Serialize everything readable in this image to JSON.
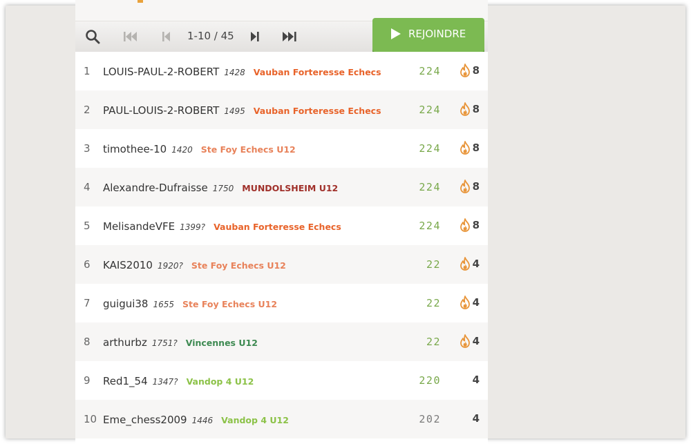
{
  "toolbar": {
    "page_info": "1-10 / 45",
    "join_label": "REJOINDRE"
  },
  "colors": {
    "score_green": "#78a84a",
    "score_gray": "#7a7a7a",
    "team_orange": "#e8632a",
    "team_salmon": "#e8825a",
    "team_darkred": "#a0302a",
    "team_green": "#3e8a52",
    "team_lime": "#8cc248",
    "fire": "#e8953a",
    "join_button": "#7cba52"
  },
  "players": [
    {
      "rank": "1",
      "name": "LOUIS-PAUL-2-ROBERT",
      "rating": "1428",
      "team": "Vauban Forteresse Echecs",
      "team_color": "#e8632a",
      "score": "224",
      "score_color": "#78a84a",
      "fire": true,
      "streak": "8"
    },
    {
      "rank": "2",
      "name": "PAUL-LOUIS-2-ROBERT",
      "rating": "1495",
      "team": "Vauban Forteresse Echecs",
      "team_color": "#e8632a",
      "score": "224",
      "score_color": "#78a84a",
      "fire": true,
      "streak": "8"
    },
    {
      "rank": "3",
      "name": "timothee-10",
      "rating": "1420",
      "team": "Ste Foy Echecs U12",
      "team_color": "#e8825a",
      "score": "224",
      "score_color": "#78a84a",
      "fire": true,
      "streak": "8"
    },
    {
      "rank": "4",
      "name": "Alexandre-Dufraisse",
      "rating": "1750",
      "team": "MUNDOLSHEIM U12",
      "team_color": "#a0302a",
      "score": "224",
      "score_color": "#78a84a",
      "fire": true,
      "streak": "8"
    },
    {
      "rank": "5",
      "name": "MelisandeVFE",
      "rating": "1399?",
      "team": "Vauban Forteresse Echecs",
      "team_color": "#e8632a",
      "score": "224",
      "score_color": "#78a84a",
      "fire": true,
      "streak": "8"
    },
    {
      "rank": "6",
      "name": "KAIS2010",
      "rating": "1920?",
      "team": "Ste Foy Echecs U12",
      "team_color": "#e8825a",
      "score": "22",
      "score_color": "#78a84a",
      "fire": true,
      "streak": "4"
    },
    {
      "rank": "7",
      "name": "guigui38",
      "rating": "1655",
      "team": "Ste Foy Echecs U12",
      "team_color": "#e8825a",
      "score": "22",
      "score_color": "#78a84a",
      "fire": true,
      "streak": "4"
    },
    {
      "rank": "8",
      "name": "arthurbz",
      "rating": "1751?",
      "team": "Vincennes U12",
      "team_color": "#3e8a52",
      "score": "22",
      "score_color": "#78a84a",
      "fire": true,
      "streak": "4"
    },
    {
      "rank": "9",
      "name": "Red1_54",
      "rating": "1347?",
      "team": "Vandop 4 U12",
      "team_color": "#8cc248",
      "score": "220",
      "score_color": "#78a84a",
      "fire": false,
      "streak": "4"
    },
    {
      "rank": "10",
      "name": "Eme_chess2009",
      "rating": "1446",
      "team": "Vandop 4 U12",
      "team_color": "#8cc248",
      "score": "202",
      "score_color": "#7a7a7a",
      "fire": false,
      "streak": "4"
    }
  ]
}
